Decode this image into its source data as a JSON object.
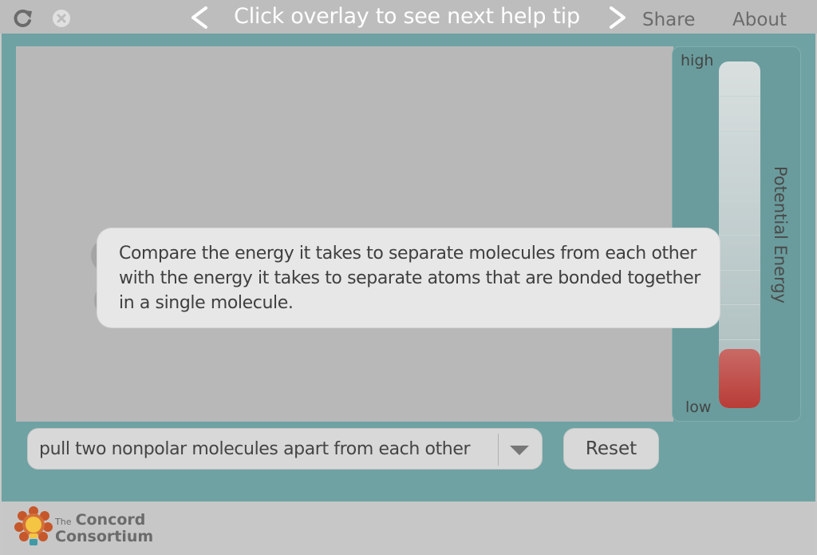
{
  "topbar": {
    "help_tip": "Click overlay to see next help tip",
    "prev_glyph": "<",
    "next_glyph": ">",
    "share_label": "Share",
    "about_label": "About",
    "reload_icon": "reload-icon",
    "close_icon": "close-icon"
  },
  "energy_meter": {
    "high_label": "high",
    "low_label": "low",
    "axis_label": "Potential Energy",
    "level_fraction": 0.17,
    "fill_color": "#b93c37"
  },
  "controls": {
    "interaction_selected": "pull two nonpolar molecules apart from each other",
    "reset_label": "Reset"
  },
  "overlay": {
    "tip_text": "Compare the energy it takes to separate molecules from each other with the energy it takes to separate atoms that are bonded together in a single molecule."
  },
  "footer": {
    "logo_the": "The",
    "logo_concord": "Concord",
    "logo_consortium": "Consortium"
  },
  "colors": {
    "teal_background": "#6fa2a3",
    "sim_background": "#b8b8b8"
  }
}
